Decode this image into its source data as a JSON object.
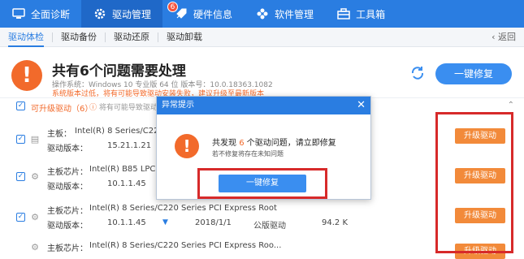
{
  "nav": {
    "items": [
      {
        "label": "全面诊断",
        "icon": "monitor-icon"
      },
      {
        "label": "驱动管理",
        "icon": "gear-icon",
        "badge": "6"
      },
      {
        "label": "硬件信息",
        "icon": "rocket-icon"
      },
      {
        "label": "软件管理",
        "icon": "apps-icon"
      },
      {
        "label": "工具箱",
        "icon": "toolbox-icon"
      }
    ]
  },
  "subnav": {
    "items": [
      "驱动体检",
      "驱动备份",
      "驱动还原",
      "驱动卸载"
    ],
    "back": "返回"
  },
  "header": {
    "title": "共有6个问题需要处理",
    "os_line": "操作系统：Windows 10 专业版 64 位       版本号：10.0.18363.1082",
    "notice_line": "系统版本过低，将有可能导致驱动安装失败，建议升级至最新版本",
    "fix_button": "一键修复"
  },
  "list": {
    "group_label": "可升级驱动（6）",
    "group_notice": "将有可能导致驱动安装失败，建议升级至最新版本",
    "rows": [
      {
        "label1": "主板：",
        "value1": "Intel(R) 8 Series/C220",
        "label2": "驱动版本：",
        "value2": "15.21.1.21",
        "button": "升级驱动"
      },
      {
        "label1": "主板芯片：",
        "value1": "Intel(R) B85 LPC",
        "label2": "驱动版本：",
        "value2": "10.1.1.45",
        "button": "升级驱动"
      },
      {
        "label1": "主板芯片：",
        "value1": "Intel(R) 8 Series/C220 Series PCI Express Root",
        "label2": "驱动版本：",
        "value2": "10.1.1.45",
        "date": "2018/1/1",
        "type": "公版驱动",
        "size": "94.2 K",
        "button": "升级驱动"
      },
      {
        "label1": "主板芯片：",
        "value1": "Intel(R) 8 Series/C220 Series PCI Express Roo...",
        "label2": "",
        "value2": "",
        "button": "升级驱动"
      }
    ]
  },
  "dialog": {
    "title": "异常提示",
    "msg_prefix": "共发现",
    "msg_count": "6",
    "msg_suffix": "个驱动问题，请立即修复",
    "sub": "若不修复将存在未知问题",
    "button": "一键修复"
  },
  "colors": {
    "primary": "#2a7de1",
    "warning": "#f26a2b",
    "highlight": "#d72a2a"
  }
}
